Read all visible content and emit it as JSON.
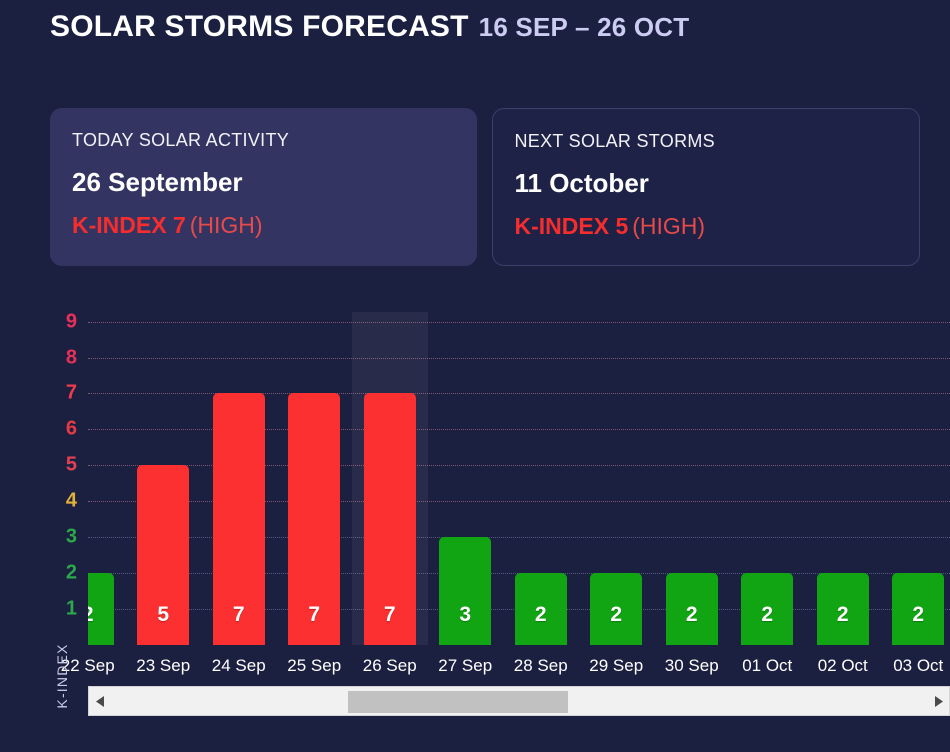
{
  "header": {
    "title": "SOLAR STORMS FORECAST",
    "range": "16 SEP – 26 OCT"
  },
  "cards": [
    {
      "label": "TODAY SOLAR ACTIVITY",
      "date": "26 September",
      "kindex_main": "K-INDEX 7",
      "kindex_level": "(HIGH)"
    },
    {
      "label": "NEXT SOLAR STORMS",
      "date": "11 October",
      "kindex_main": "K-INDEX 5",
      "kindex_level": "(HIGH)"
    }
  ],
  "chart_data": {
    "type": "bar",
    "title": "SOLAR STORMS FORECAST 16 SEP – 26 OCT",
    "xlabel": "",
    "ylabel": "K-INDEX",
    "ylim": [
      0,
      9.6
    ],
    "grid": true,
    "legend": "none",
    "categories": [
      "22 Sep",
      "23 Sep",
      "24 Sep",
      "25 Sep",
      "26 Sep",
      "27 Sep",
      "28 Sep",
      "29 Sep",
      "30 Sep",
      "01 Oct",
      "02 Oct",
      "03 Oct"
    ],
    "values": [
      2,
      5,
      7,
      7,
      7,
      3,
      2,
      2,
      2,
      2,
      2,
      2
    ],
    "bar_colors": [
      "green",
      "red",
      "red",
      "red",
      "red",
      "green",
      "green",
      "green",
      "green",
      "green",
      "green",
      "green"
    ],
    "highlighted_category": "26 Sep",
    "first_partial": true,
    "last_partial": true,
    "yticks": [
      {
        "value": 9,
        "label": "9",
        "color": "#e8305a"
      },
      {
        "value": 8,
        "label": "8",
        "color": "#e8305a"
      },
      {
        "value": 7,
        "label": "7",
        "color": "#ef3b4e"
      },
      {
        "value": 6,
        "label": "6",
        "color": "#e83a46"
      },
      {
        "value": 5,
        "label": "5",
        "color": "#e34052"
      },
      {
        "value": 4,
        "label": "4",
        "color": "#e0b13a"
      },
      {
        "value": 3,
        "label": "3",
        "color": "#2aa84a"
      },
      {
        "value": 2,
        "label": "2",
        "color": "#2aa84a"
      },
      {
        "value": 1,
        "label": "1",
        "color": "#2aa84a"
      }
    ]
  },
  "scrollbar": {
    "left_arrow": "left-arrow",
    "right_arrow": "right-arrow",
    "thumb_position_pct": 29,
    "thumb_width_pct": 27
  },
  "colors": {
    "background": "#1c2040",
    "card_primary": "#343463",
    "card_secondary": "#1e2246",
    "bar_red": "#fc3030",
    "bar_green": "#11a413",
    "accent_range": "#ccccf2",
    "kindex_red": "#f62d2d"
  }
}
